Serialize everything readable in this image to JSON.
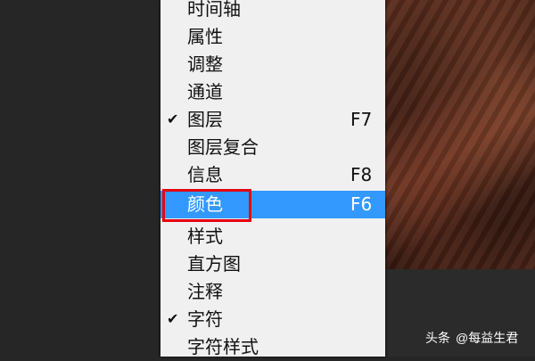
{
  "menu": {
    "items": [
      {
        "label": "时间轴",
        "shortcut": "",
        "checked": false,
        "selected": false
      },
      {
        "label": "属性",
        "shortcut": "",
        "checked": false,
        "selected": false
      },
      {
        "label": "调整",
        "shortcut": "",
        "checked": false,
        "selected": false
      },
      {
        "label": "通道",
        "shortcut": "",
        "checked": false,
        "selected": false
      },
      {
        "label": "图层",
        "shortcut": "F7",
        "checked": true,
        "selected": false
      },
      {
        "label": "图层复合",
        "shortcut": "",
        "checked": false,
        "selected": false
      },
      {
        "label": "信息",
        "shortcut": "F8",
        "checked": false,
        "selected": false
      },
      {
        "label": "颜色",
        "shortcut": "F6",
        "checked": false,
        "selected": true
      },
      {
        "label": "样式",
        "shortcut": "",
        "checked": false,
        "selected": false
      },
      {
        "label": "直方图",
        "shortcut": "",
        "checked": false,
        "selected": false
      },
      {
        "label": "注释",
        "shortcut": "",
        "checked": false,
        "selected": false
      },
      {
        "label": "字符",
        "shortcut": "",
        "checked": true,
        "selected": false
      },
      {
        "label": "字符样式",
        "shortcut": "",
        "checked": false,
        "selected": false
      }
    ],
    "selected_color": "#3399ff",
    "highlight_color": "#e60012",
    "check_icon": "checkmark-icon"
  },
  "watermark": {
    "source": "头条",
    "author": "@每益生君"
  }
}
